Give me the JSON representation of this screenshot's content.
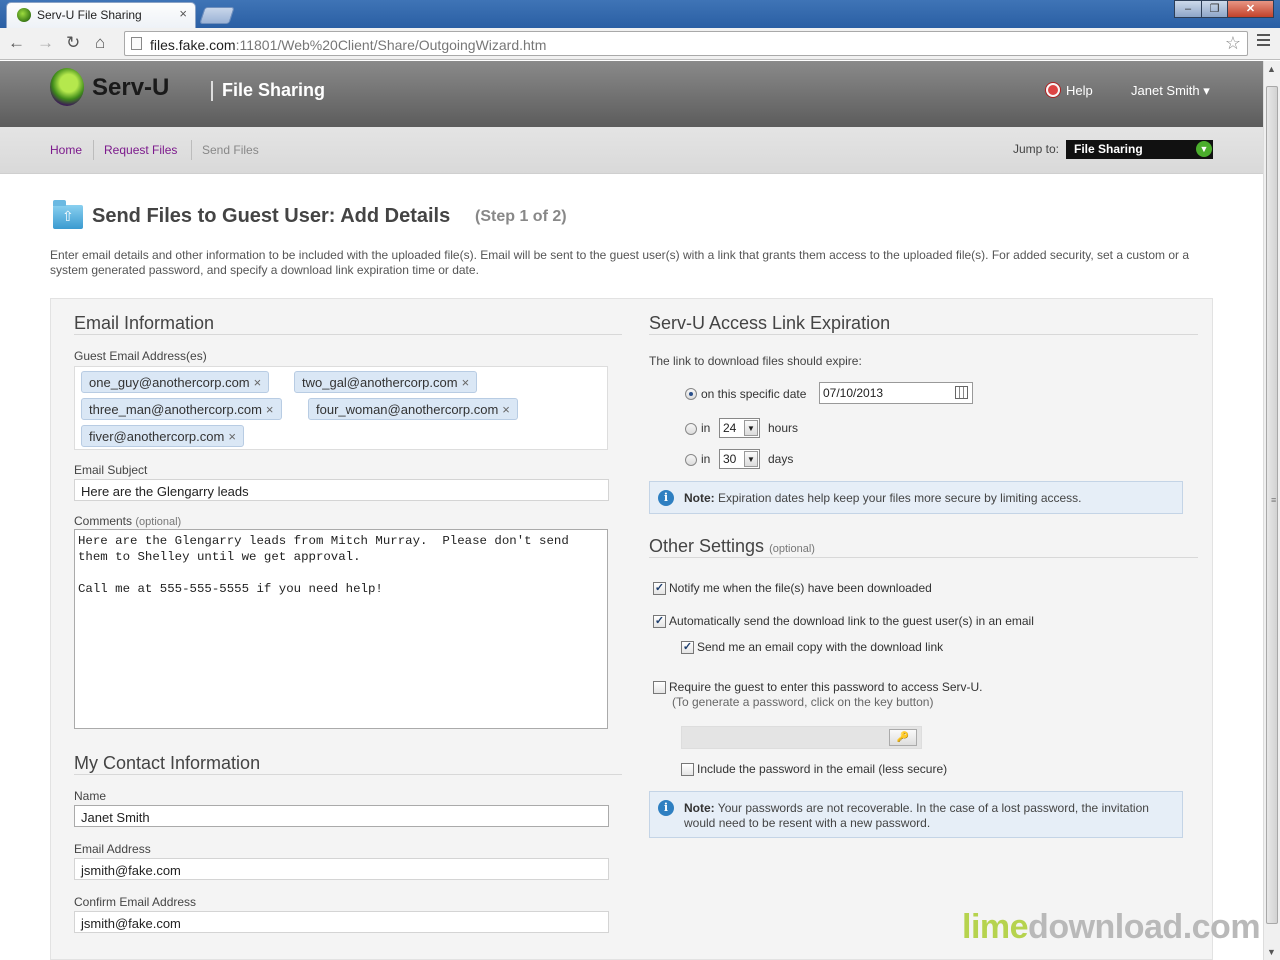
{
  "browser": {
    "tab_title": "Serv-U File Sharing",
    "tab_close": "×",
    "url_host": "files.fake.com",
    "url_rest": ":11801/Web%20Client/Share/OutgoingWizard.htm",
    "back_icon": "back-arrow-icon",
    "forward_icon": "forward-arrow-icon",
    "reload_icon": "reload-icon",
    "home_icon": "home-icon",
    "star_icon": "star-icon",
    "window_min": "‒",
    "window_max": "❐",
    "window_close": "✕"
  },
  "header": {
    "logo_text": "Serv-U",
    "title": "File Sharing",
    "help_label": "Help",
    "user_label": "Janet Smith ▾"
  },
  "subnav": {
    "home": "Home",
    "request_files": "Request Files",
    "send_files": "Send Files",
    "jump_label": "Jump to:",
    "jump_value": "File Sharing"
  },
  "page": {
    "title": "Send Files to Guest User: Add Details",
    "step": "(Step 1 of 2)",
    "description": "Enter email details and other information to be included with the uploaded file(s). Email will be sent to the guest user(s) with a link that grants them access to the uploaded file(s). For added security, set a custom or a system generated password, and specify a download link expiration time or date."
  },
  "email_info": {
    "section_title": "Email Information",
    "guest_label": "Guest Email Address(es)",
    "guests": [
      "one_guy@anothercorp.com",
      "two_gal@anothercorp.com",
      "three_man@anothercorp.com",
      "four_woman@anothercorp.com",
      "fiver@anothercorp.com"
    ],
    "chip_remove": "×",
    "subject_label": "Email Subject",
    "subject_value": "Here are the Glengarry leads",
    "comments_label": "Comments",
    "comments_optional": "(optional)",
    "comments_value": "Here are the Glengarry leads from Mitch Murray.  Please don't send them to Shelley until we get approval.\n\nCall me at 555-555-5555 if you need help!"
  },
  "contact": {
    "section_title": "My Contact Information",
    "name_label": "Name",
    "name_value": "Janet Smith",
    "email_label": "Email Address",
    "email_value": "jsmith@fake.com",
    "confirm_label": "Confirm Email Address",
    "confirm_value": "jsmith@fake.com"
  },
  "expiration": {
    "section_title": "Serv-U Access Link Expiration",
    "intro": "The link to download files should expire:",
    "opt_date_label": "on this specific date",
    "date_value": "07/10/2013",
    "opt_hours_in": "in",
    "hours_value": "24",
    "hours_label": "hours",
    "opt_days_in": "in",
    "days_value": "30",
    "days_label": "days",
    "selected": "date",
    "note_bold": "Note:",
    "note_text": "Expiration dates help keep your files more secure by limiting access."
  },
  "other": {
    "section_title": "Other Settings",
    "optional": "(optional)",
    "notify_label": "Notify me when the file(s) have been downloaded",
    "notify_checked": true,
    "auto_send_label": "Automatically send the download link to the guest user(s) in an email",
    "auto_send_checked": true,
    "copy_label": "Send me an email copy with the download link",
    "copy_checked": true,
    "require_pw_label": "Require the guest to enter this password to access Serv-U.",
    "require_pw_checked": false,
    "pw_hint": "(To generate a password, click on the key button)",
    "include_pw_label": "Include the password in the email (less secure)",
    "include_pw_checked": false,
    "note_bold": "Note:",
    "note_text": "Your passwords are not recoverable. In the case of a lost password, the invitation would need to be resent with a new password."
  },
  "watermark": {
    "part1": "lime",
    "part2": "download.com"
  },
  "colors": {
    "nav_link": "#7c1a8c",
    "accent_green": "#4bae2c",
    "info_blue": "#2e7fc1"
  }
}
